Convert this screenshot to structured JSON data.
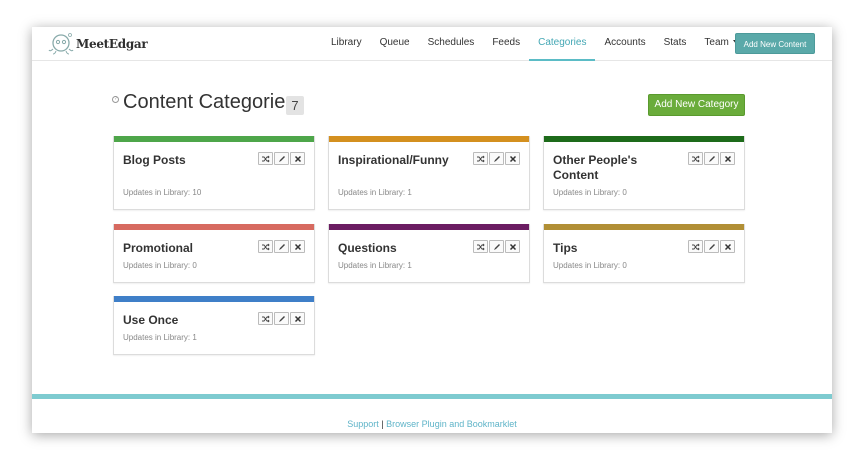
{
  "app": {
    "logo_text": "MeetEdgar"
  },
  "nav": {
    "items": [
      {
        "label": "Library"
      },
      {
        "label": "Queue"
      },
      {
        "label": "Schedules"
      },
      {
        "label": "Feeds"
      },
      {
        "label": "Categories"
      },
      {
        "label": "Accounts"
      },
      {
        "label": "Stats"
      },
      {
        "label": "Team"
      }
    ],
    "active": "Categories",
    "add_content_label": "Add New Content"
  },
  "page": {
    "title": "Content Categories",
    "count": "7",
    "help_glyph": "?",
    "add_category_label": "Add New Category"
  },
  "categories": [
    {
      "name": "Blog Posts",
      "updates": "Updates in Library: 10",
      "color": "#4ea64a"
    },
    {
      "name": "Inspirational/Funny",
      "updates": "Updates in Library: 1",
      "color": "#d4901f"
    },
    {
      "name": "Other People's Content",
      "updates": "Updates in Library: 0",
      "color": "#1d6b1a"
    },
    {
      "name": "Promotional",
      "updates": "Updates in Library: 0",
      "color": "#d76a60"
    },
    {
      "name": "Questions",
      "updates": "Updates in Library: 1",
      "color": "#6b1d62"
    },
    {
      "name": "Tips",
      "updates": "Updates in Library: 0",
      "color": "#b18f35"
    },
    {
      "name": "Use Once",
      "updates": "Updates in Library: 1",
      "color": "#3f7fc8"
    }
  ],
  "card_actions": [
    "shuffle-icon",
    "pencil-icon",
    "close-icon"
  ],
  "footer": {
    "support_label": "Support",
    "separator": "|",
    "plugin_label": "Browser Plugin and Bookmarklet"
  },
  "colors": {
    "accent": "#5bbcc6",
    "add_category": "#6aac3b",
    "add_content": "#5aa9a9"
  }
}
